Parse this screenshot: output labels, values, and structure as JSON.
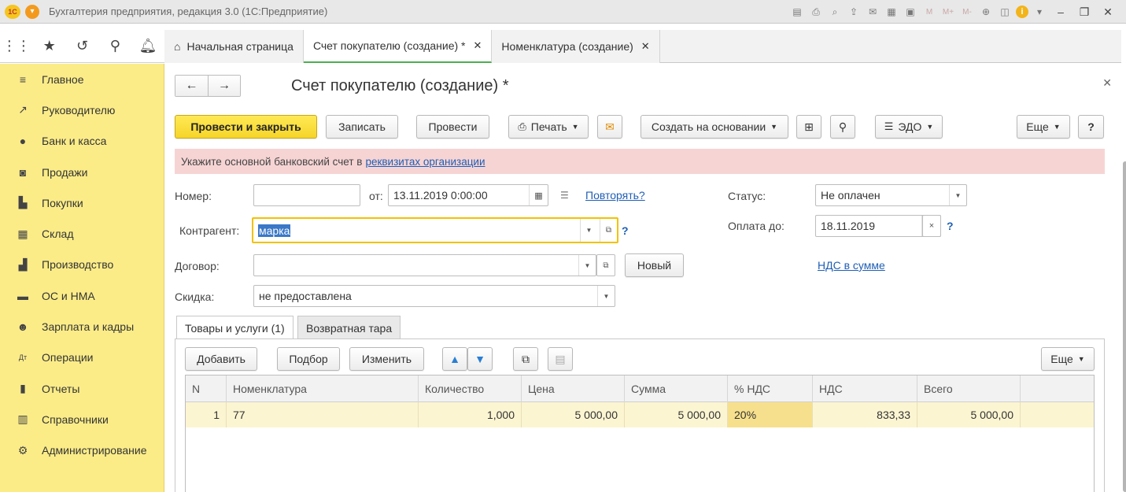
{
  "window": {
    "title": "Бухгалтерия предприятия, редакция 3.0  (1С:Предприятие)",
    "logo_text": "1С"
  },
  "tabs": [
    {
      "label": "Начальная страница",
      "active": false
    },
    {
      "label": "Счет покупателю (создание) *",
      "active": true
    },
    {
      "label": "Номенклатура (создание)",
      "active": false
    }
  ],
  "sidebar": {
    "items": [
      {
        "label": "Главное",
        "icon": "menu-lines-icon"
      },
      {
        "label": "Руководителю",
        "icon": "trend-icon"
      },
      {
        "label": "Банк и касса",
        "icon": "coin-icon"
      },
      {
        "label": "Продажи",
        "icon": "bag-icon"
      },
      {
        "label": "Покупки",
        "icon": "cart-icon"
      },
      {
        "label": "Склад",
        "icon": "warehouse-icon"
      },
      {
        "label": "Производство",
        "icon": "factory-icon"
      },
      {
        "label": "ОС и НМА",
        "icon": "truck-icon"
      },
      {
        "label": "Зарплата и кадры",
        "icon": "person-icon"
      },
      {
        "label": "Операции",
        "icon": "dt-kt-icon"
      },
      {
        "label": "Отчеты",
        "icon": "bar-chart-icon"
      },
      {
        "label": "Справочники",
        "icon": "books-icon"
      },
      {
        "label": "Администрирование",
        "icon": "gear-icon"
      }
    ]
  },
  "form": {
    "title": "Счет покупателю (создание) *",
    "toolbar": {
      "post_close": "Провести и закрыть",
      "save": "Записать",
      "post": "Провести",
      "print": "Печать",
      "create_based": "Создать на основании",
      "edo": "ЭДО",
      "more": "Еще",
      "help": "?"
    },
    "warning": {
      "text": "Укажите основной банковский счет в",
      "link": "реквизитах организации"
    },
    "fields": {
      "number_label": "Номер:",
      "number_value": "",
      "from_label": "от:",
      "date_value": "13.11.2019  0:00:00",
      "repeat_link": "Повторять?",
      "status_label": "Статус:",
      "status_value": "Не оплачен",
      "counterparty_label": "Контрагент:",
      "counterparty_value": "марка",
      "pay_until_label": "Оплата до:",
      "pay_until_value": "18.11.2019",
      "contract_label": "Договор:",
      "contract_value": "",
      "new_button": "Новый",
      "vat_link": "НДС в сумме",
      "discount_label": "Скидка:",
      "discount_value": "не предоставлена",
      "help_mark": "?"
    },
    "inner_tabs": [
      {
        "label": "Товары и услуги (1)",
        "active": true
      },
      {
        "label": "Возвратная тара",
        "active": false
      }
    ],
    "table_toolbar": {
      "add": "Добавить",
      "pick": "Подбор",
      "change": "Изменить",
      "more": "Еще"
    },
    "table": {
      "columns": [
        "N",
        "Номенклатура",
        "Количество",
        "Цена",
        "Сумма",
        "% НДС",
        "НДС",
        "Всего"
      ],
      "rows": [
        [
          "1",
          "77",
          "1,000",
          "5 000,00",
          "5 000,00",
          "20%",
          "833,33",
          "5 000,00"
        ]
      ]
    }
  }
}
